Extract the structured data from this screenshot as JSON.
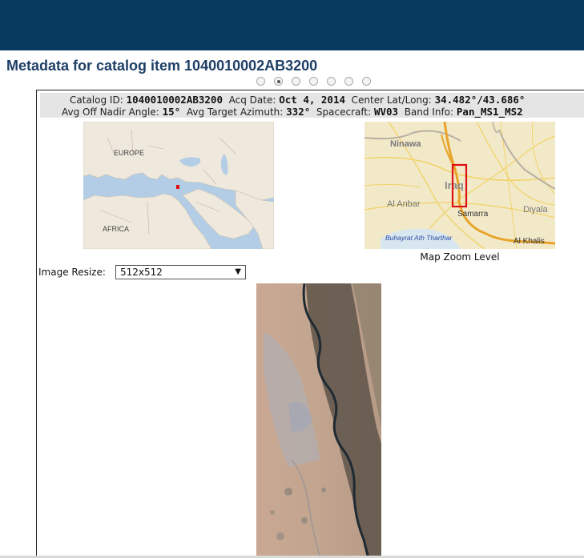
{
  "header": {
    "title": "Metadata for catalog item 1040010002AB3200"
  },
  "pager": {
    "count": 7,
    "active_index": 1
  },
  "metadata": {
    "catalog_id_label": "Catalog ID:",
    "catalog_id_value": "1040010002AB3200",
    "acq_date_label": "Acq Date:",
    "acq_date_value": "Oct 4, 2014",
    "center_label": "Center Lat/Long:",
    "center_value": "34.482°/43.686°",
    "off_nadir_label": "Avg Off Nadir Angle:",
    "off_nadir_value": "15°",
    "azimuth_label": "Avg Target Azimuth:",
    "azimuth_value": "332°",
    "spacecraft_label": "Spacecraft:",
    "spacecraft_value": "WV03",
    "band_label": "Band Info:",
    "band_value": "Pan_MS1_MS2"
  },
  "overview_map": {
    "labels": {
      "europe": "EUROPE",
      "africa": "AFRICA"
    }
  },
  "zoom_map": {
    "caption": "Map Zoom Level",
    "labels": {
      "ninawa": "Ninawa",
      "iraq": "Iraq",
      "al_anbar": "Al Anbar",
      "samarra": "Samarra",
      "diyala": "Diyala",
      "lake": "Buhayrat Ath Tharthar",
      "al_khalis": "Al Khalis"
    }
  },
  "resize": {
    "label": "Image Resize:",
    "selected": "512x512"
  },
  "colors": {
    "header_bg": "#063a5f",
    "title_text": "#1e3f66",
    "metadata_bg": "#e5e5e5",
    "footprint": "#dd1111"
  }
}
